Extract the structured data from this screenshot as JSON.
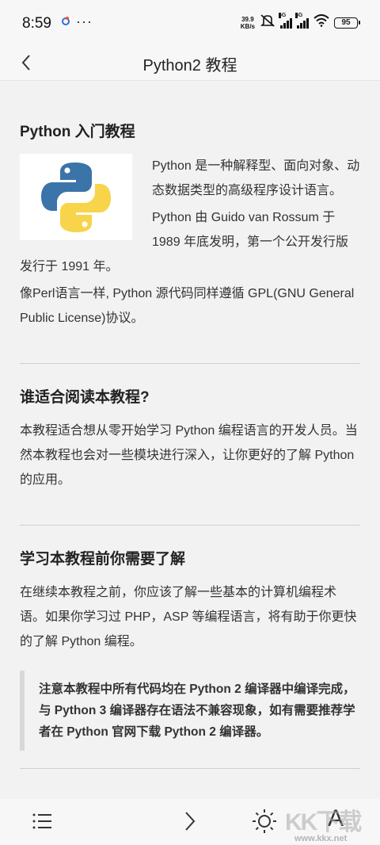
{
  "status_bar": {
    "time": "8:59",
    "net_speed_value": "39.9",
    "net_speed_unit": "KB/s",
    "signal1_label": "5G",
    "signal2_label": "5G",
    "battery": "95"
  },
  "nav": {
    "title": "Python2 教程"
  },
  "intro": {
    "title": "Python 入门教程",
    "p1": "Python 是一种解释型、面向对象、动态数据类型的高级程序设计语言。",
    "p2": "Python 由 Guido van Rossum 于 1989 年底发明，第一个公开发行版发行于 1991 年。",
    "p3": "像Perl语言一样, Python 源代码同样遵循 GPL(GNU General Public License)协议。"
  },
  "audience": {
    "title": "谁适合阅读本教程?",
    "p": "本教程适合想从零开始学习 Python 编程语言的开发人员。当然本教程也会对一些模块进行深入，让你更好的了解 Python 的应用。"
  },
  "prereq": {
    "title": "学习本教程前你需要了解",
    "p": "在继续本教程之前，你应该了解一些基本的计算机编程术语。如果你学习过 PHP，ASP 等编程语言，将有助于你更快的了解 Python 编程。",
    "note": "注意本教程中所有代码均在 Python 2 编译器中编译完成，与 Python 3 编译器存在语法不兼容现象，如有需要推荐学者在 Python 官网下载 Python 2 编译器。"
  },
  "bottom_bar": {
    "font_label": "A"
  },
  "watermark": {
    "text": "KK下载",
    "url": "www.kkx.net"
  },
  "colors": {
    "python_blue": "#3b74a8",
    "python_yellow": "#f7d44a"
  }
}
